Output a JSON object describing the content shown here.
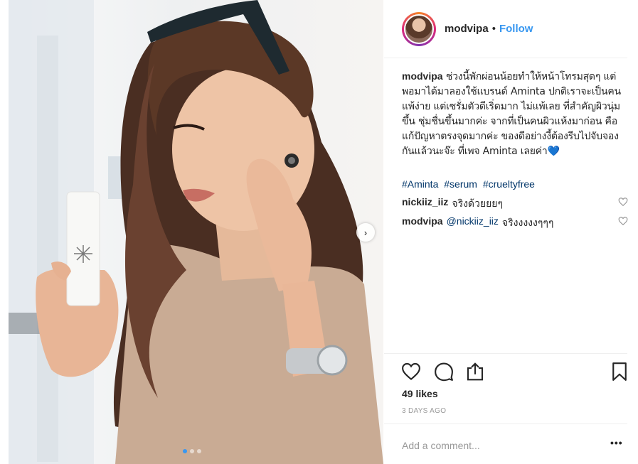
{
  "post": {
    "username": "modvipa",
    "separator": "•",
    "follow_label": "Follow",
    "caption_username": "modvipa",
    "caption_text": "ช่วงนี้พักผ่อนน้อยทำให้หน้าโทรมสุดๆ แต่พอมาได้มาลองใช้แบรนด์ Aminta ปกติเราจะเป็นคนแพ้ง่าย แต่เซรั่มตัวดีเริ่ดมาก ไม่แพ้เลย ที่สำคัญผิวนุ่มขึ้น ชุ่มชื่นขึ้นมากค่ะ จากที่เป็นคนผิวแห้งมาก่อน คือแก้ปัญหาตรงจุดมากค่ะ ของดีอย่างงี้ต้องรีบไปจับจองกันแล้วนะจ๊ะ ที่เพจ Aminta เลยค่า",
    "caption_emoji": "💙",
    "hashtags": [
      "#Aminta",
      "#serum",
      "#crueltyfree"
    ],
    "comments": [
      {
        "username": "nickiiz_iiz",
        "mention": "",
        "text": "จริงด้วยยยๆ"
      },
      {
        "username": "modvipa",
        "mention": "@nickiiz_iiz",
        "text": "จริงงงงงๆๆๆ"
      }
    ],
    "likes": "49 likes",
    "time": "3 DAYS AGO",
    "add_comment_placeholder": "Add a comment...",
    "more": "•••",
    "carousel_total": 3,
    "carousel_active": 1
  },
  "icons": {
    "like": "heart-outline-icon",
    "comment": "speech-bubble-icon",
    "share": "share-icon",
    "save": "bookmark-icon",
    "next": "chevron-right-icon"
  },
  "colors": {
    "link": "#3897f0",
    "hashtag": "#003569",
    "muted": "#999999",
    "text": "#262626"
  }
}
